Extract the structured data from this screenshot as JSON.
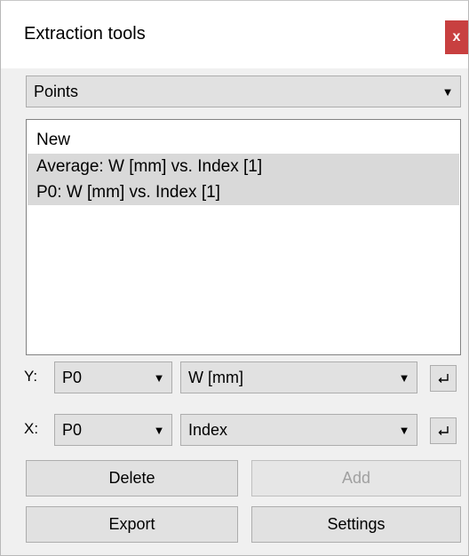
{
  "window": {
    "title": "Extraction tools",
    "close_label": "x"
  },
  "mode_select": {
    "value": "Points"
  },
  "list": {
    "items": [
      {
        "label": "New",
        "selected": false
      },
      {
        "label": "Average: W [mm] vs. Index [1]",
        "selected": true
      },
      {
        "label": "P0: W [mm] vs. Index [1]",
        "selected": true
      }
    ]
  },
  "y_axis": {
    "label": "Y:",
    "source": "P0",
    "quantity": "W [mm]"
  },
  "x_axis": {
    "label": "X:",
    "source": "P0",
    "quantity": "Index"
  },
  "buttons": {
    "delete": "Delete",
    "add": "Add",
    "export": "Export",
    "settings": "Settings"
  },
  "colors": {
    "close_bg": "#c84040",
    "selection": "#d9d9d9",
    "button_bg": "#e1e1e1"
  }
}
